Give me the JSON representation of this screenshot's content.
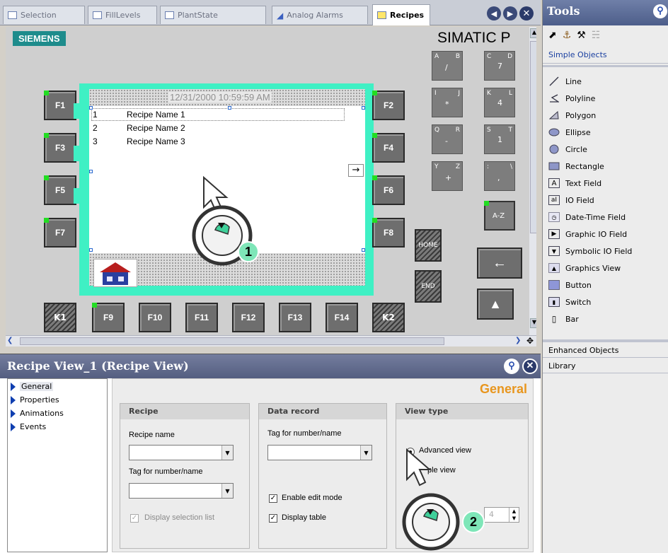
{
  "tabs": [
    {
      "label": "Selection"
    },
    {
      "label": "FillLevels"
    },
    {
      "label": "PlantState"
    },
    {
      "label": "Analog Alarms"
    },
    {
      "label": "Recipes"
    }
  ],
  "hmi": {
    "brand": "SIEMENS",
    "model": "SIMATIC P",
    "datetime": "12/31/2000 10:59:59 AM",
    "recipes": [
      {
        "num": "1",
        "name": "Recipe Name 1"
      },
      {
        "num": "2",
        "name": "Recipe Name 2"
      },
      {
        "num": "3",
        "name": "Recipe Name 3"
      }
    ],
    "fkeys_left": [
      "F1",
      "F3",
      "F5",
      "F7"
    ],
    "fkeys_right": [
      "F2",
      "F4",
      "F6",
      "F8"
    ],
    "fkeys_bottom": [
      "F9",
      "F10",
      "F11",
      "F12",
      "F13",
      "F14"
    ],
    "kkeys": [
      "K1",
      "K2"
    ],
    "keypad": [
      {
        "tl": "A",
        "tr": "B",
        "main": "/"
      },
      {
        "tl": "C",
        "tr": "D",
        "main": "7"
      },
      {
        "tl": "I",
        "tr": "J",
        "main": "*"
      },
      {
        "tl": "K",
        "tr": "L",
        "main": "4"
      },
      {
        "tl": "Q",
        "tr": "R",
        "main": "-"
      },
      {
        "tl": "S",
        "tr": "T",
        "main": "1"
      },
      {
        "tl": "Y",
        "tr": "Z",
        "main": "+"
      },
      {
        "tl": ":",
        "tr": "\\",
        "main": ","
      }
    ],
    "az_key": "A-Z",
    "home_key": "HOME",
    "end_key": "END",
    "callout1": "1",
    "callout2": "2"
  },
  "tools": {
    "title": "Tools",
    "section_simple": "Simple Objects",
    "items": [
      {
        "label": "Line",
        "icon": "line-icon"
      },
      {
        "label": "Polyline",
        "icon": "polyline-icon"
      },
      {
        "label": "Polygon",
        "icon": "polygon-icon"
      },
      {
        "label": "Ellipse",
        "icon": "ellipse-icon"
      },
      {
        "label": "Circle",
        "icon": "circle-icon"
      },
      {
        "label": "Rectangle",
        "icon": "rectangle-icon"
      },
      {
        "label": "Text Field",
        "icon": "text-field-icon"
      },
      {
        "label": "IO Field",
        "icon": "io-field-icon"
      },
      {
        "label": "Date-Time Field",
        "icon": "date-time-icon"
      },
      {
        "label": "Graphic IO Field",
        "icon": "graphic-io-icon"
      },
      {
        "label": "Symbolic IO Field",
        "icon": "symbolic-io-icon"
      },
      {
        "label": "Graphics View",
        "icon": "graphics-view-icon"
      },
      {
        "label": "Button",
        "icon": "button-icon"
      },
      {
        "label": "Switch",
        "icon": "switch-icon"
      },
      {
        "label": "Bar",
        "icon": "bar-icon"
      }
    ],
    "section_enhanced": "Enhanced Objects",
    "section_library": "Library"
  },
  "inspector": {
    "title": "Recipe View_1 (Recipe View)",
    "nav": [
      "General",
      "Properties",
      "Animations",
      "Events"
    ],
    "section_title": "General",
    "recipe_group": {
      "header": "Recipe",
      "recipe_name_label": "Recipe name",
      "recipe_name_value": "",
      "tag_label": "Tag for number/name",
      "tag_value": "",
      "display_selection_list": "Display selection list"
    },
    "data_group": {
      "header": "Data record",
      "tag_label": "Tag for number/name",
      "tag_value": "",
      "enable_edit_mode": "Enable edit mode",
      "display_table": "Display table"
    },
    "view_group": {
      "header": "View type",
      "advanced_view": "Advanced view",
      "simple_view_partial": "ple view",
      "spinner_value": "4"
    }
  },
  "colors": {
    "frame": "#3ff0c4",
    "siemens": "#1e8c8c",
    "general_heading": "#e8961e",
    "nav_triangle": "#0f3fb0"
  }
}
